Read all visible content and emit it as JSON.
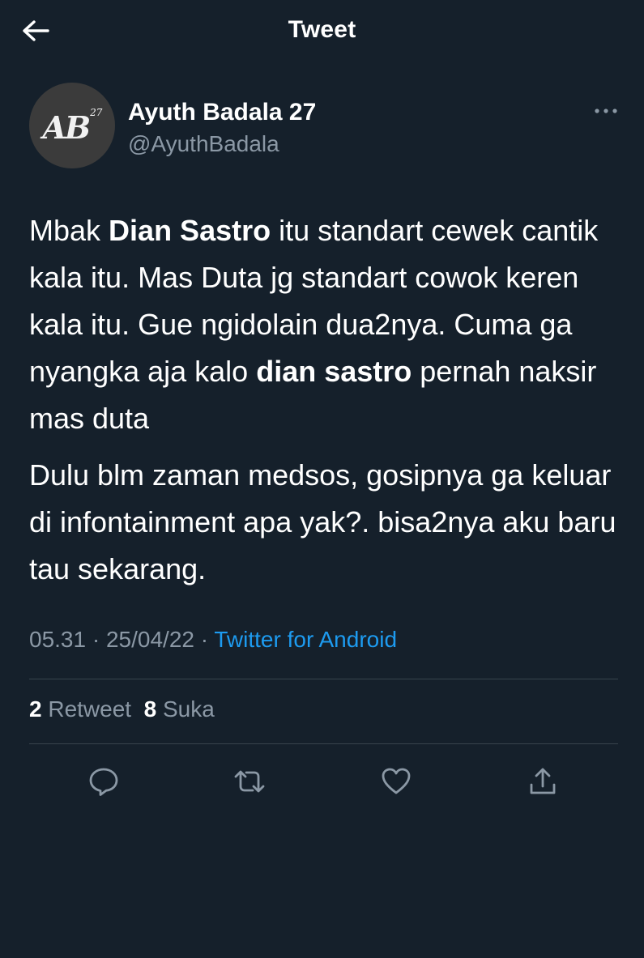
{
  "header": {
    "title": "Tweet",
    "back_icon": "arrow-left-icon"
  },
  "author": {
    "name": "Ayuth Badala 27",
    "handle": "@AyuthBadala",
    "avatar": {
      "text": "AB",
      "superscript": "27",
      "background": "#3b3b3b"
    },
    "more_icon": "more-horizontal-icon"
  },
  "tweet": {
    "paragraph1": [
      {
        "text": "Mbak ",
        "bold": false
      },
      {
        "text": "Dian Sastro",
        "bold": true
      },
      {
        "text": " itu standart cewek cantik kala itu. Mas Duta jg standart cowok keren kala itu. Gue ngidolain dua2nya. Cuma ga nyangka aja kalo ",
        "bold": false
      },
      {
        "text": "dian sastro",
        "bold": true
      },
      {
        "text": " pernah naksir mas duta",
        "bold": false
      }
    ],
    "paragraph2": "Dulu blm zaman medsos, gosipnya ga keluar di infontainment apa yak?. bisa2nya aku baru tau sekarang.",
    "time": "05.31",
    "date": "25/04/22",
    "separator": "·",
    "source": "Twitter for Android"
  },
  "stats": {
    "retweet_count": "2",
    "retweet_label": "Retweet",
    "like_count": "8",
    "like_label": "Suka"
  },
  "actions": [
    {
      "icon": "reply-icon"
    },
    {
      "icon": "retweet-icon"
    },
    {
      "icon": "heart-icon"
    },
    {
      "icon": "share-icon"
    }
  ],
  "colors": {
    "background": "#15202b",
    "text_primary": "#ffffff",
    "text_secondary": "#8b98a5",
    "link": "#1d9bf0",
    "divider": "#38444d"
  }
}
